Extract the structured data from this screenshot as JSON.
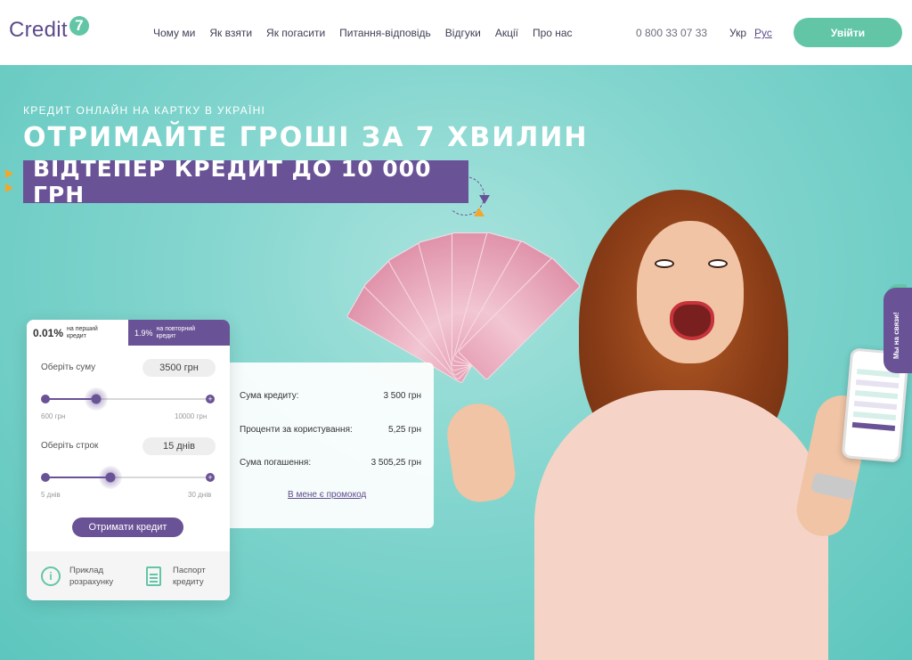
{
  "header": {
    "logo_text": "Credit",
    "logo_mark": "7",
    "nav": [
      "Чому ми",
      "Як взяти",
      "Як погасити",
      "Питання-відповідь",
      "Відгуки",
      "Акції",
      "Про нас"
    ],
    "phone": "0 800 33 07 33",
    "lang_uk": "Укр",
    "lang_ru": "Рус",
    "login_label": "Увійти"
  },
  "hero": {
    "subtitle": "КРЕДИТ ОНЛАЙН НА КАРТКУ В УКРАЇНІ",
    "title": "ОТРИМАЙТЕ ГРОШІ ЗА 7 ХВИЛИН",
    "banner": "ВІДТЕПЕР КРЕДИТ ДО 10 000 ГРН"
  },
  "calculator": {
    "tab_first_rate": "0.01%",
    "tab_first_label_1": "на перший",
    "tab_first_label_2": "кредит",
    "tab_repeat_rate": "1.9%",
    "tab_repeat_label_1": "на повторний",
    "tab_repeat_label_2": "кредит",
    "amount_label": "Оберіть суму",
    "amount_value": "3500 грн",
    "amount_min": "600 грн",
    "amount_max": "10000 грн",
    "amount_fraction": 0.31,
    "term_label": "Оберіть строк",
    "term_value": "15 днів",
    "term_min": "5 днів",
    "term_max": "30 днів",
    "term_fraction": 0.4,
    "submit_label": "Отримати кредит",
    "example_label_1": "Приклад",
    "example_label_2": "розрахунку",
    "passport_label_1": "Паспорт",
    "passport_label_2": "кредиту"
  },
  "summary": {
    "rows": [
      {
        "label": "Сума кредиту:",
        "value": "3 500 грн"
      },
      {
        "label": "Проценти за користування:",
        "value": "5,25 грн"
      },
      {
        "label": "Сума погашення:",
        "value": "3 505,25 грн"
      }
    ],
    "promo_link": "В мене є промокод"
  },
  "side_tab": {
    "label": "Мы на связи!"
  },
  "colors": {
    "purple": "#6a5296",
    "green": "#62c6a6",
    "teal_bg": "#84d6cf",
    "orange": "#f3a72a"
  }
}
